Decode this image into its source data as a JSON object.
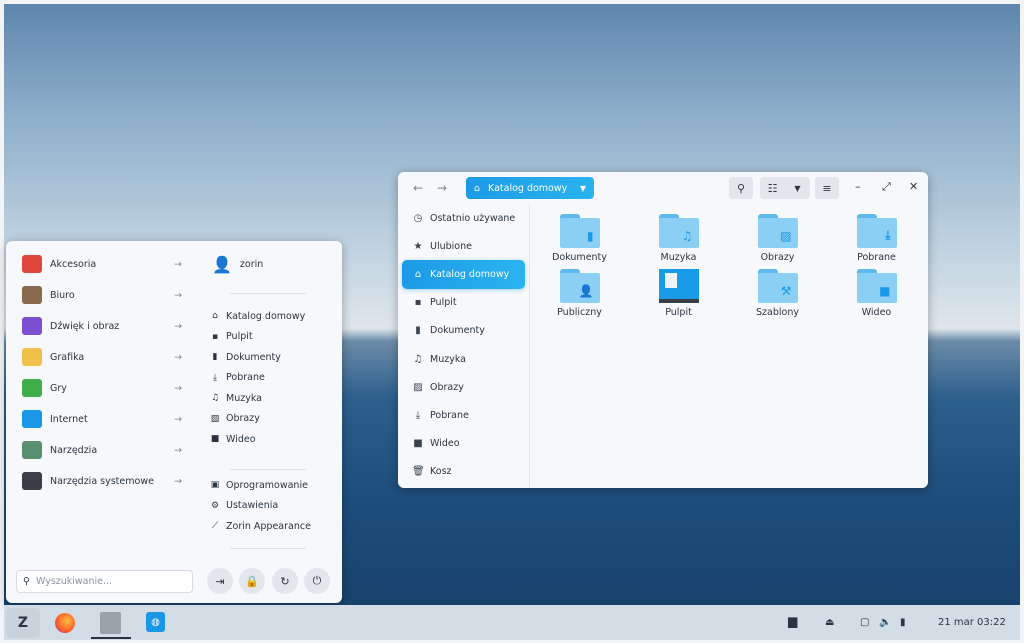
{
  "file_manager": {
    "location": "Katalog domowy",
    "sidebar": [
      {
        "label": "Ostatnio używane",
        "icon": "clock-icon"
      },
      {
        "label": "Ulubione",
        "icon": "star-icon"
      },
      {
        "label": "Katalog domowy",
        "icon": "home-icon",
        "active": true
      },
      {
        "label": "Pulpit",
        "icon": "desktop-icon"
      },
      {
        "label": "Dokumenty",
        "icon": "document-icon"
      },
      {
        "label": "Muzyka",
        "icon": "music-icon"
      },
      {
        "label": "Obrazy",
        "icon": "image-icon"
      },
      {
        "label": "Pobrane",
        "icon": "download-icon"
      },
      {
        "label": "Wideo",
        "icon": "video-icon"
      },
      {
        "label": "Kosz",
        "icon": "trash-icon"
      }
    ],
    "items": [
      {
        "label": "Dokumenty"
      },
      {
        "label": "Muzyka"
      },
      {
        "label": "Obrazy"
      },
      {
        "label": "Pobrane"
      },
      {
        "label": "Publiczny"
      },
      {
        "label": "Pulpit"
      },
      {
        "label": "Szablony"
      },
      {
        "label": "Wideo"
      }
    ]
  },
  "start_menu": {
    "categories": [
      "Akcesoria",
      "Biuro",
      "Dźwięk i obraz",
      "Grafika",
      "Gry",
      "Internet",
      "Narzędzia",
      "Narzędzia systemowe"
    ],
    "user": "zorin",
    "places": [
      "Katalog domowy",
      "Pulpit",
      "Dokumenty",
      "Pobrane",
      "Muzyka",
      "Obrazy",
      "Wideo"
    ],
    "system": [
      "Oprogramowanie",
      "Ustawienia",
      "Zorin Appearance"
    ],
    "search_placeholder": "Wyszukiwanie..."
  },
  "taskbar": {
    "date": "21 mar",
    "time": "03:22"
  }
}
